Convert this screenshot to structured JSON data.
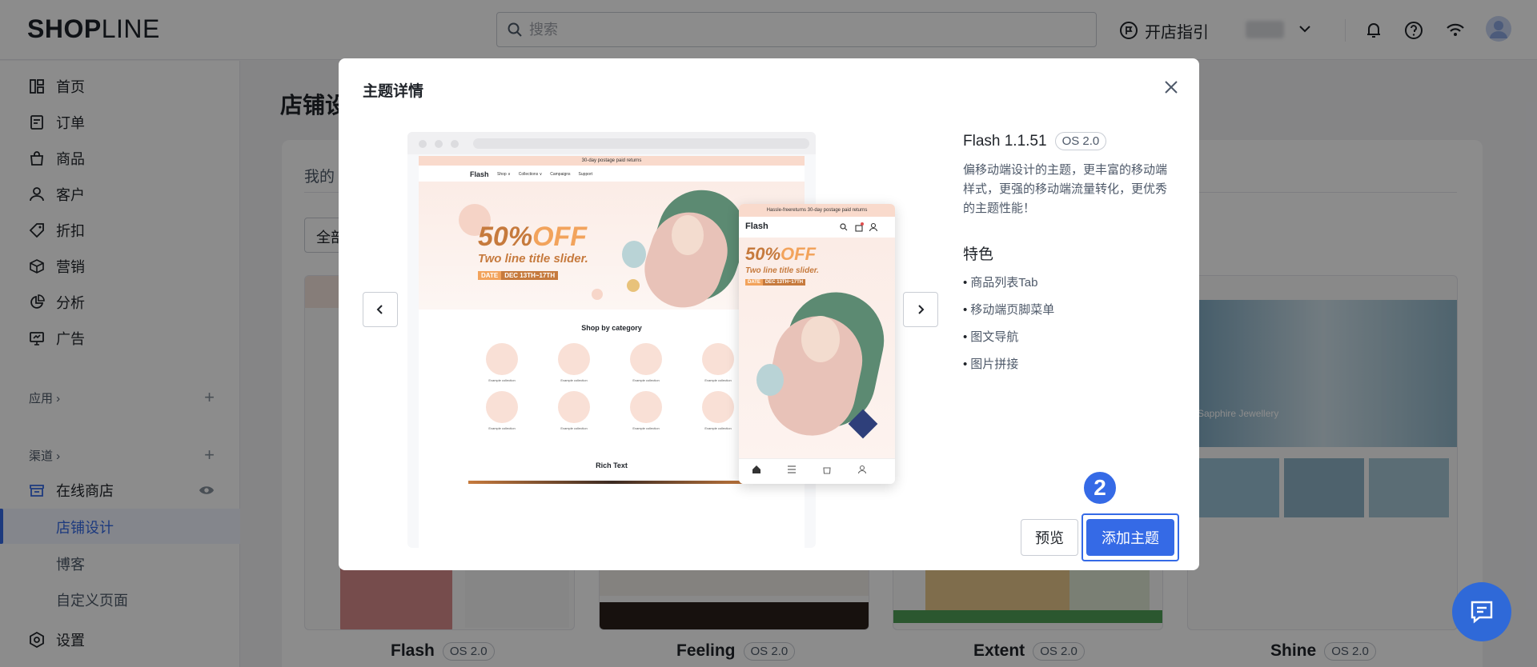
{
  "brand": {
    "logo_bold": "SHOP",
    "logo_thin": "LINE"
  },
  "header": {
    "search_placeholder": "搜索",
    "guide_label": "开店指引"
  },
  "sidebar": {
    "items": [
      {
        "label": "首页",
        "icon": "home-grid-icon"
      },
      {
        "label": "订单",
        "icon": "order-icon"
      },
      {
        "label": "商品",
        "icon": "bag-icon"
      },
      {
        "label": "客户",
        "icon": "user-icon"
      },
      {
        "label": "折扣",
        "icon": "tag-icon"
      },
      {
        "label": "营销",
        "icon": "cube-icon"
      },
      {
        "label": "分析",
        "icon": "pie-chart-icon"
      },
      {
        "label": "广告",
        "icon": "monitor-icon"
      }
    ],
    "apps_label": "应用",
    "channels_label": "渠道",
    "online_store_label": "在线商店",
    "sub_items": [
      "店铺设计",
      "博客",
      "自定义页面"
    ],
    "settings_label": "设置"
  },
  "main": {
    "page_title": "店铺设",
    "tab_my": "我的",
    "filter_label": "全部",
    "themes": [
      {
        "name": "Flash",
        "os": "OS 2.0"
      },
      {
        "name": "Feeling",
        "os": "OS 2.0"
      },
      {
        "name": "Extent",
        "os": "OS 2.0"
      },
      {
        "name": "Shine",
        "os": "OS 2.0"
      }
    ],
    "shine_caption": "Sapphire Jewellery"
  },
  "modal": {
    "title": "主题详情",
    "theme_name": "Flash 1.1.51",
    "os_tag": "OS 2.0",
    "description": "偏移动端设计的主题，更丰富的移动端样式，更强的移动端流量转化，更优秀的主题性能！",
    "features_title": "特色",
    "features": [
      "商品列表Tab",
      "移动端页脚菜单",
      "图文导航",
      "图片拼接"
    ],
    "preview_button": "预览",
    "add_button": "添加主题",
    "step_number": "2",
    "desktop_preview": {
      "banner_text": "30-day postage paid returns",
      "logo": "Flash",
      "nav": [
        "Shop ∨",
        "Collections ∨",
        "Campaigns",
        "Support"
      ],
      "headline": "50%",
      "headline_off": "OFF",
      "subhead": "Two line title slider.",
      "date_label": "DATE",
      "date_value": "DEC 13TH~17TH",
      "category_title": "Shop by category",
      "category_caption": "Example collection",
      "rich_text": "Rich Text"
    },
    "mobile_preview": {
      "banner_text": "Hassle-freereturns 30-day postage paid returns",
      "logo": "Flash",
      "headline": "50%",
      "headline_off": "OFF",
      "subhead": "Two line title slider.",
      "date_label": "DATE",
      "date_value": "DEC 13TH~17TH"
    }
  },
  "colors": {
    "accent": "#356ae6",
    "peach": "#f8e0d6",
    "orange": "#e88a3c"
  }
}
